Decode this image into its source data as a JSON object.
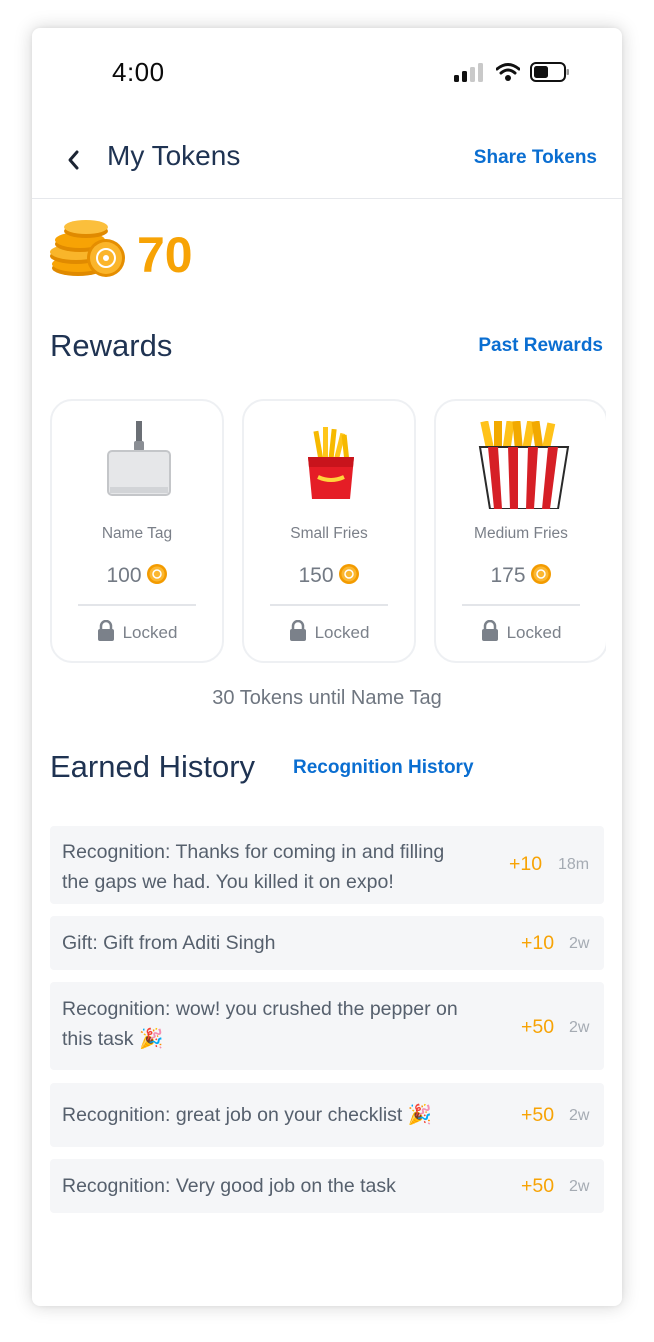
{
  "status": {
    "time": "4:00"
  },
  "header": {
    "title": "My Tokens",
    "share_label": "Share Tokens"
  },
  "balance": {
    "tokens": "70"
  },
  "rewards": {
    "heading": "Rewards",
    "past_label": "Past Rewards",
    "items": [
      {
        "name": "Name Tag",
        "cost": "100",
        "status": "Locked"
      },
      {
        "name": "Small Fries",
        "cost": "150",
        "status": "Locked"
      },
      {
        "name": "Medium Fries",
        "cost": "175",
        "status": "Locked"
      }
    ],
    "until_text": "30 Tokens until Name Tag"
  },
  "history": {
    "heading": "Earned History",
    "recognition_label": "Recognition History",
    "items": [
      {
        "line1": "Recognition:  Thanks for coming in and filling",
        "line2": "the gaps we had. You killed it on expo!",
        "amount": "+10",
        "time": "18m"
      },
      {
        "line1": "Gift:  Gift from Aditi Singh",
        "line2": "",
        "amount": "+10",
        "time": "2w"
      },
      {
        "line1": "Recognition:  wow! you crushed the pepper on",
        "line2": "this task 🎉",
        "amount": "+50",
        "time": "2w"
      },
      {
        "line1": "Recognition:  great job on your checklist 🎉",
        "line2": "",
        "amount": "+50",
        "time": "2w"
      },
      {
        "line1": "Recognition:  Very good job on the task",
        "line2": "",
        "amount": "+50",
        "time": "2w"
      }
    ]
  },
  "colors": {
    "accent": "#0a6ed1",
    "token": "#f7a305",
    "heading": "#1f3352"
  }
}
